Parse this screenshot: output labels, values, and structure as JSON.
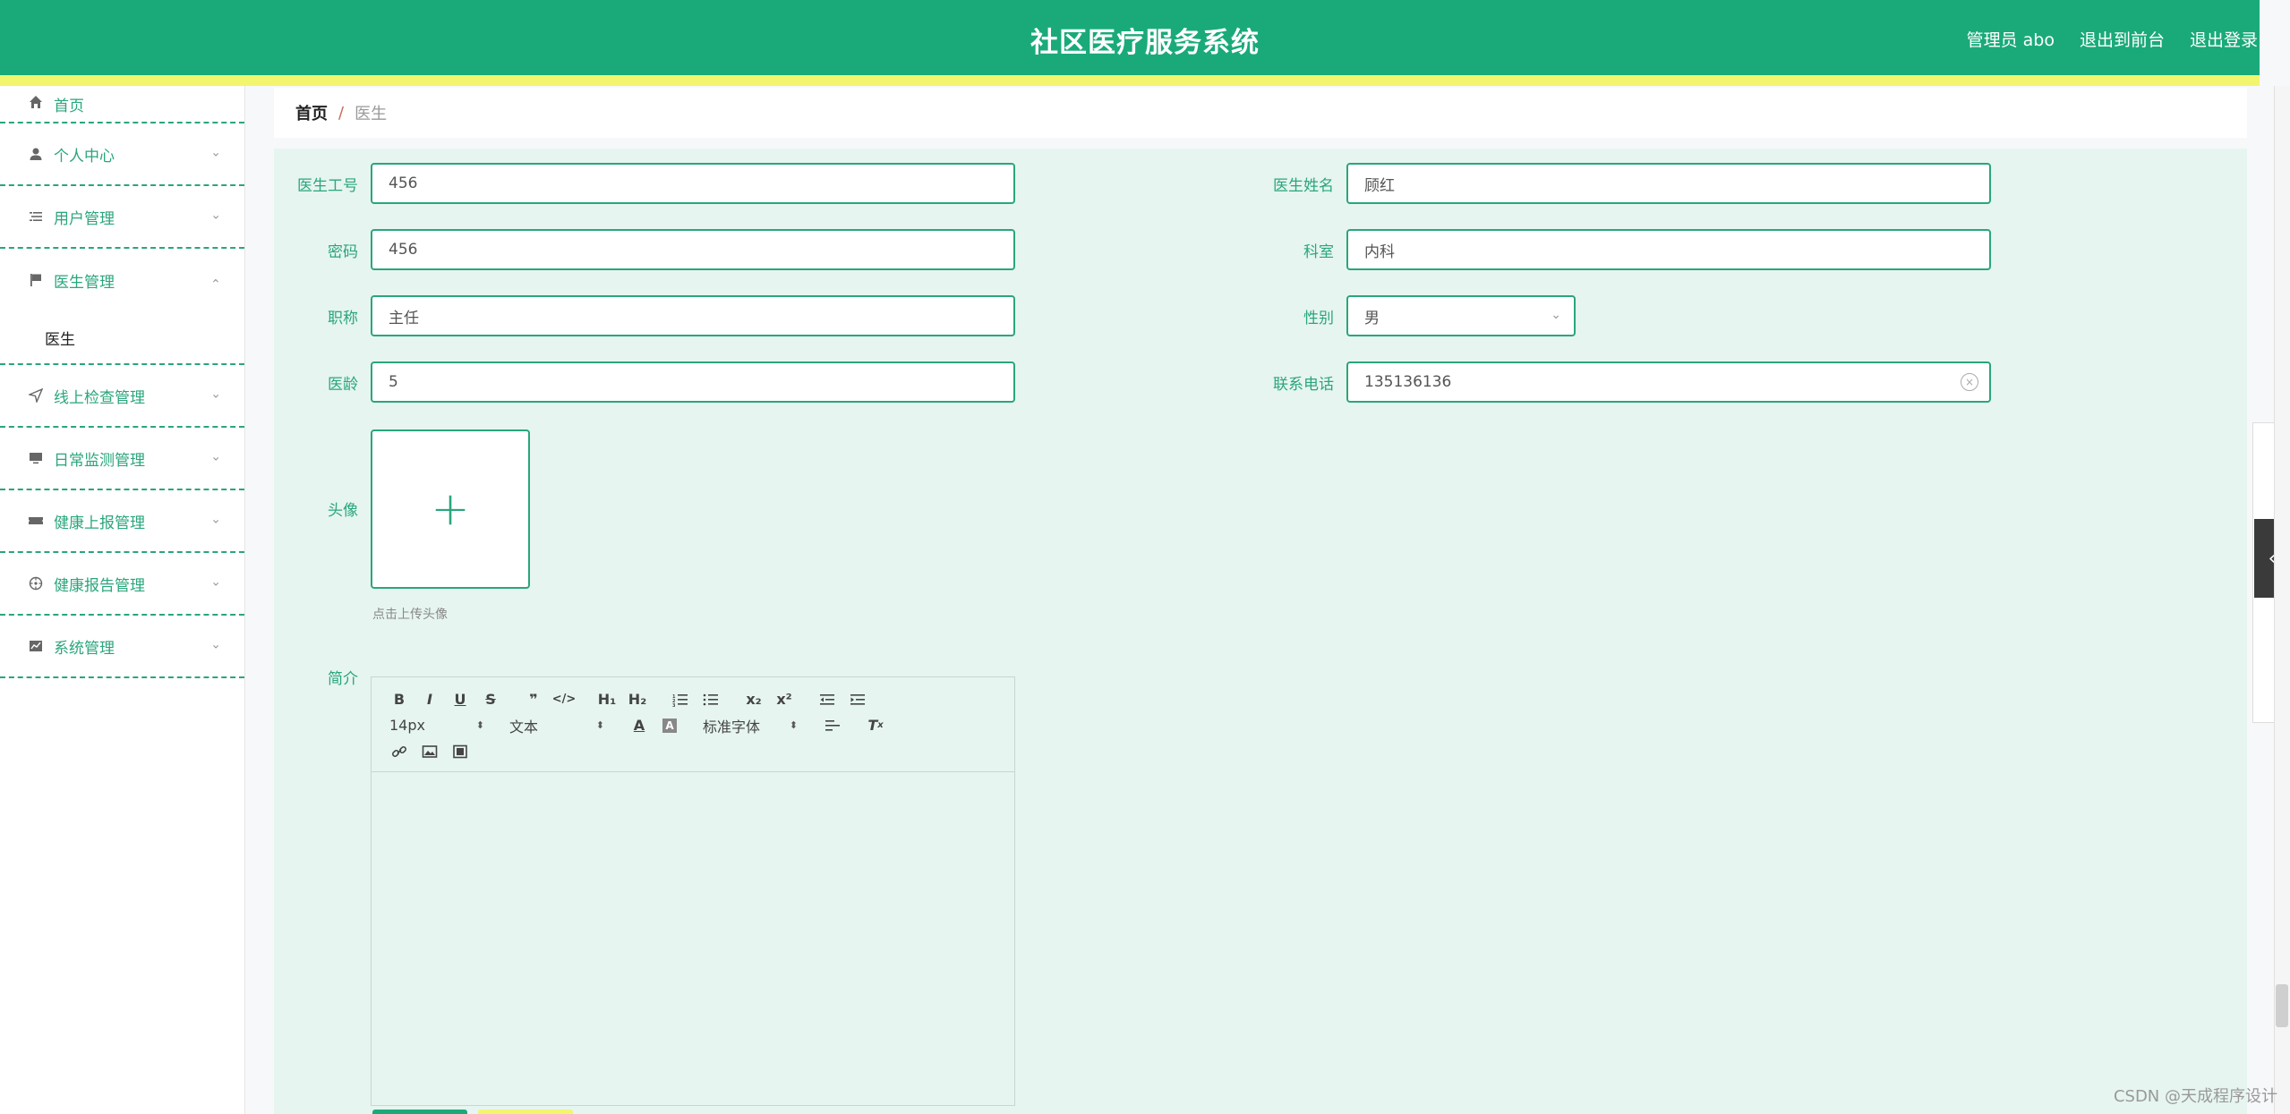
{
  "header": {
    "title": "社区医疗服务系统",
    "user": "管理员 abo",
    "to_front": "退出到前台",
    "logout": "退出登录"
  },
  "sidebar": {
    "items": [
      {
        "label": "首页",
        "icon": "home-icon"
      },
      {
        "label": "个人中心",
        "icon": "user-icon"
      },
      {
        "label": "用户管理",
        "icon": "list-icon"
      },
      {
        "label": "医生管理",
        "icon": "flag-icon",
        "sub": "医生"
      },
      {
        "label": "线上检查管理",
        "icon": "send-icon"
      },
      {
        "label": "日常监测管理",
        "icon": "monitor-icon"
      },
      {
        "label": "健康上报管理",
        "icon": "ticket-icon"
      },
      {
        "label": "健康报告管理",
        "icon": "compass-icon"
      },
      {
        "label": "系统管理",
        "icon": "chart-icon"
      }
    ]
  },
  "breadcrumb": {
    "home": "首页",
    "sep": "/",
    "current": "医生"
  },
  "form": {
    "doctor_id": {
      "label": "医生工号",
      "value": "456"
    },
    "doctor_name": {
      "label": "医生姓名",
      "value": "顾红"
    },
    "password": {
      "label": "密码",
      "value": "456"
    },
    "department": {
      "label": "科室",
      "value": "内科"
    },
    "title": {
      "label": "职称",
      "value": "主任"
    },
    "gender": {
      "label": "性别",
      "value": "男"
    },
    "years": {
      "label": "医龄",
      "value": "5"
    },
    "phone": {
      "label": "联系电话",
      "value": "135136136"
    },
    "avatar": {
      "label": "头像",
      "hint": "点击上传头像"
    },
    "intro": {
      "label": "简介"
    }
  },
  "editor": {
    "font_size": "14px",
    "header_select": "文本",
    "font_family": "标准字体"
  },
  "watermark": "CSDN @天成程序设计",
  "colors": {
    "primary": "#1aaa7a",
    "stripe": "#f2f56e",
    "panel": "#e6f5f0"
  }
}
